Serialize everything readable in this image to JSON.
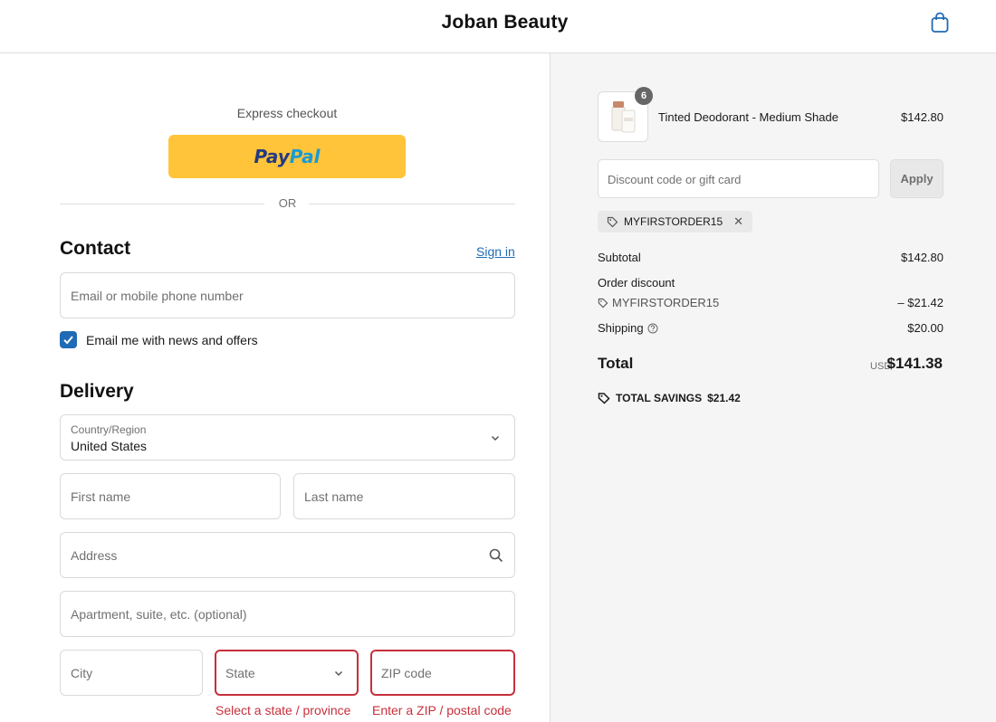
{
  "header": {
    "brand": "Joban Beauty",
    "cart_icon": "shopping-bag-icon"
  },
  "express": {
    "label": "Express checkout",
    "paypal_part1": "Pay",
    "paypal_part2": "Pal",
    "or_label": "OR"
  },
  "contact": {
    "title": "Contact",
    "sign_in": "Sign in",
    "email_placeholder": "Email or mobile phone number",
    "newsletter_label": "Email me with news and offers",
    "newsletter_checked": true
  },
  "delivery": {
    "title": "Delivery",
    "country_label": "Country/Region",
    "country_value": "United States",
    "first_name_placeholder": "First name",
    "last_name_placeholder": "Last name",
    "address_placeholder": "Address",
    "apartment_placeholder": "Apartment, suite, etc. (optional)",
    "city_placeholder": "City",
    "state_placeholder": "State",
    "zip_placeholder": "ZIP code",
    "state_error": "Select a state / province",
    "zip_error": "Enter a ZIP / postal code"
  },
  "summary": {
    "product": {
      "name": "Tinted Deodorant - Medium Shade",
      "price": "$142.80",
      "quantity": "6"
    },
    "discount_placeholder": "Discount code or gift card",
    "apply_label": "Apply",
    "applied_code": "MYFIRSTORDER15",
    "subtotal_label": "Subtotal",
    "subtotal_value": "$142.80",
    "order_discount_label": "Order discount",
    "discount_code": "MYFIRSTORDER15",
    "discount_value": "– $21.42",
    "shipping_label": "Shipping",
    "shipping_value": "$20.00",
    "total_label": "Total",
    "currency": "USD",
    "total_value": "$141.38",
    "savings_label": "TOTAL SAVINGS",
    "savings_value": "$21.42"
  },
  "colors": {
    "accent": "#1f6bb5",
    "error": "#c6303c",
    "paypal_yellow": "#ffc439",
    "summary_bg": "#f5f5f5"
  }
}
